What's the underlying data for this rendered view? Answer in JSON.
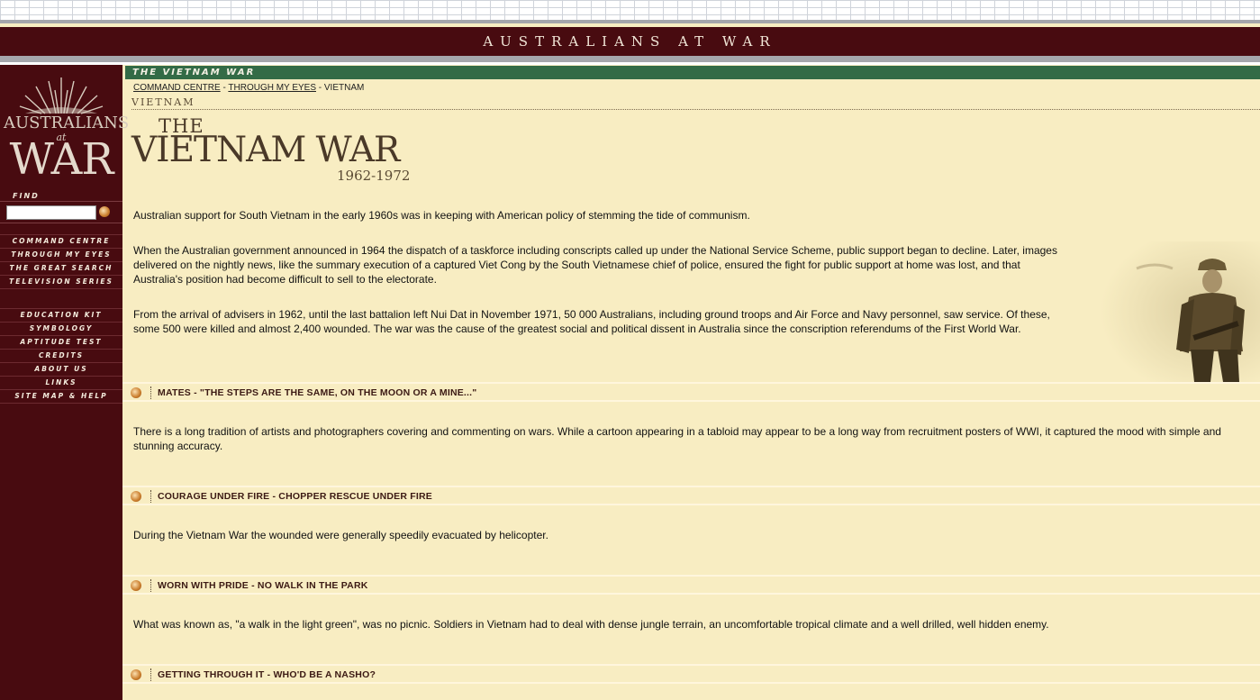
{
  "site": {
    "title_bar": "AUSTRALIANS AT WAR"
  },
  "logo": {
    "top": "AUSTRALIANS",
    "middle": "at",
    "bottom": "WAR"
  },
  "sidebar": {
    "find_label": "FIND",
    "search": {
      "value": "",
      "placeholder": ""
    },
    "nav_primary": [
      "COMMAND CENTRE",
      "THROUGH MY EYES",
      "THE GREAT SEARCH",
      "TELEVISION SERIES"
    ],
    "nav_secondary": [
      "EDUCATION KIT",
      "SYMBOLOGY",
      "APTITUDE TEST",
      "CREDITS",
      "ABOUT US",
      "LINKS",
      "SITE MAP & HELP"
    ]
  },
  "main": {
    "section_title": "THE VIETNAM WAR",
    "breadcrumb": {
      "c1": "COMMAND CENTRE",
      "sep1": " - ",
      "c2": "THROUGH MY EYES",
      "sep2": " - ",
      "c3": "VIETNAM"
    },
    "page_label": "VIETNAM",
    "heading": {
      "the": "THE",
      "main": "VIETNAM WAR",
      "years": "1962-1972"
    },
    "paragraphs": [
      "Australian support for South Vietnam in the early 1960s was in keeping with American policy of stemming the tide of communism.",
      "When the Australian government announced in 1964 the dispatch of a taskforce including conscripts called up under the National Service Scheme, public support began to decline. Later, images delivered on the nightly news, like the summary execution of a captured Viet Cong by the South Vietnamese chief of police, ensured the fight for public support at home was lost, and that Australia's position had become difficult to sell to the electorate.",
      "From the arrival of advisers in 1962, until the last battalion left Nui Dat in November 1971, 50 000 Australians, including ground troops and Air Force and Navy personnel, saw service. Of these, some 500 were killed and almost 2,400 wounded. The war was the cause of the greatest social and political dissent in Australia since the conscription referendums of the First World War."
    ],
    "stories": [
      {
        "title": "MATES - \"THE STEPS ARE THE SAME, ON THE MOON OR A MINE...\"",
        "text": "There is a long tradition of artists and photographers covering and commenting on wars. While a cartoon appearing in a tabloid may appear to be a long way from recruitment posters of WWI, it captured the mood with simple and stunning accuracy."
      },
      {
        "title": "COURAGE UNDER FIRE - CHOPPER RESCUE UNDER FIRE",
        "text": "During the Vietnam War the wounded were generally speedily evacuated by helicopter."
      },
      {
        "title": "WORN WITH PRIDE - NO WALK IN THE PARK",
        "text": "What was known as, \"a walk in the light green\", was no picnic. Soldiers in Vietnam had to deal with dense jungle terrain, an uncomfortable tropical climate and a well drilled, well hidden enemy."
      },
      {
        "title": "GETTING THROUGH IT - WHO'D BE A NASHO?",
        "text": ""
      }
    ]
  },
  "colors": {
    "maroon": "#480b10",
    "green": "#336b46",
    "cream": "#f8edc2",
    "heading_brown": "#4a3928"
  },
  "icons": {
    "story_bullet": "orange-arrow-bullet-icon",
    "search_go": "go-arrow-icon"
  }
}
